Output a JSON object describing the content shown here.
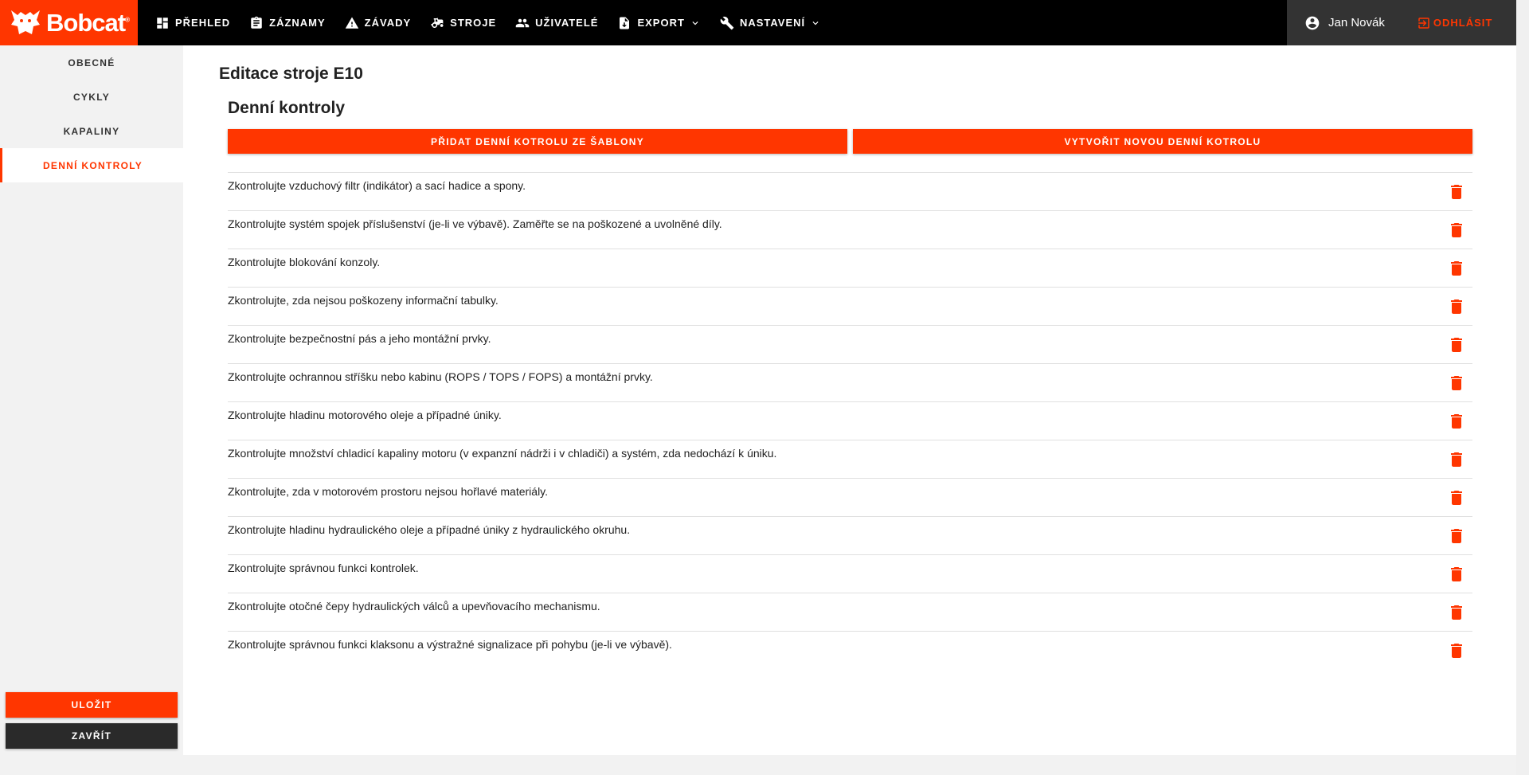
{
  "brand": {
    "name": "Bobcat",
    "mark": "®",
    "accent": "#ff3600"
  },
  "nav": [
    {
      "label": "PŘEHLED",
      "icon": "dashboard-icon"
    },
    {
      "label": "ZÁZNAMY",
      "icon": "clipboard-icon"
    },
    {
      "label": "ZÁVADY",
      "icon": "warning-icon"
    },
    {
      "label": "STROJE",
      "icon": "tractor-icon"
    },
    {
      "label": "UŽIVATELÉ",
      "icon": "users-icon"
    },
    {
      "label": "EXPORT",
      "icon": "file-export-icon"
    },
    {
      "label": "NASTAVENÍ",
      "icon": "wrench-icon"
    }
  ],
  "user": {
    "name": "Jan Novák",
    "logout_label": "ODHLÁSIT"
  },
  "sidebar": {
    "items": [
      {
        "label": "OBECNÉ"
      },
      {
        "label": "CYKLY"
      },
      {
        "label": "KAPALINY"
      },
      {
        "label": "DENNÍ KONTROLY"
      }
    ],
    "save_label": "ULOŽIT",
    "close_label": "ZAVŘÍT"
  },
  "main": {
    "title": "Editace stroje E10",
    "section_title": "Denní kontroly",
    "add_from_template_label": "PŘIDAT DENNÍ KOTROLU ZE ŠABLONY",
    "create_new_label": "VYTVOŘIT NOVOU DENNÍ KOTROLU",
    "checks": [
      "Zkontrolujte vzduchový filtr (indikátor) a sací hadice a spony.",
      "Zkontrolujte systém spojek příslušenství (je-li ve výbavě). Zaměřte se na poškozené a uvolněné díly.",
      "Zkontrolujte blokování konzoly.",
      "Zkontrolujte, zda nejsou poškozeny informační tabulky.",
      "Zkontrolujte bezpečnostní pás a jeho montážní prvky.",
      "Zkontrolujte ochrannou stříšku nebo kabinu (ROPS / TOPS / FOPS) a montážní prvky.",
      "Zkontrolujte hladinu motorového oleje a případné úniky.",
      "Zkontrolujte množství chladicí kapaliny motoru (v expanzní nádrži i v chladiči) a systém, zda nedochází k úniku.",
      "Zkontrolujte, zda v motorovém prostoru nejsou hořlavé materiály.",
      "Zkontrolujte hladinu hydraulického oleje a případné úniky z hydraulického okruhu.",
      "Zkontrolujte správnou funkci kontrolek.",
      "Zkontrolujte otočné čepy hydraulických válců a upevňovacího mechanismu.",
      "Zkontrolujte správnou funkci klaksonu a výstražné signalizace při pohybu (je-li ve výbavě)."
    ]
  }
}
